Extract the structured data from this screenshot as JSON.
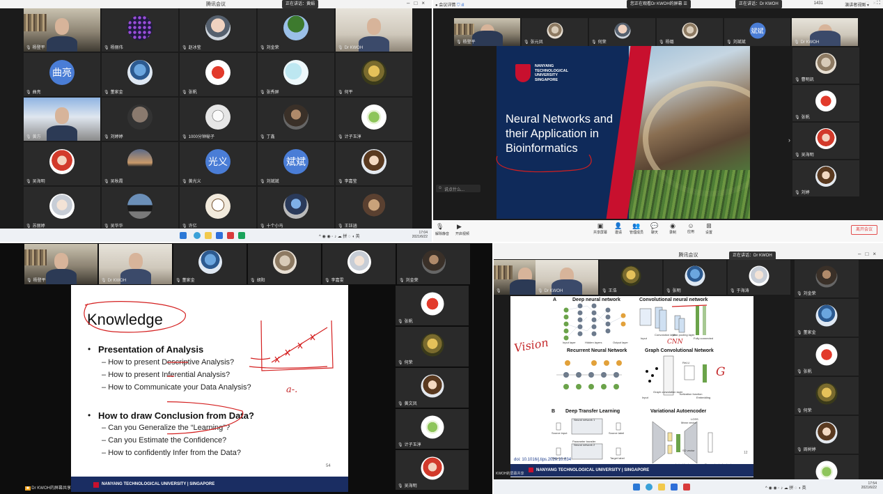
{
  "q1": {
    "title": "腾讯会议",
    "pill": "正在讲话：黄娟",
    "tiles": [
      {
        "name": "杨登平",
        "kind": "photo"
      },
      {
        "name": "杨丽伟",
        "kind": "dots"
      },
      {
        "name": "赵冰莹",
        "kind": "cartoon"
      },
      {
        "name": "刘金荣",
        "kind": "tree"
      },
      {
        "name": "Dr KWOH",
        "kind": "photo2"
      },
      {
        "name": "曲亮",
        "kind": "text",
        "text": "曲亮"
      },
      {
        "name": "董家金",
        "kind": "tree2"
      },
      {
        "name": "张帆",
        "kind": "redbird"
      },
      {
        "name": "张秀屏",
        "kind": "leaf"
      },
      {
        "name": "何平",
        "kind": "frog"
      },
      {
        "name": "黄方",
        "kind": "photo3"
      },
      {
        "name": "刘婷婷",
        "kind": "dark"
      },
      {
        "name": "1000分钟秘子",
        "kind": "sketch"
      },
      {
        "name": "丁鑫",
        "kind": "person"
      },
      {
        "name": "计子玉淳",
        "kind": "greenball"
      },
      {
        "name": "吴海明",
        "kind": "redkid"
      },
      {
        "name": "吴秋霞",
        "kind": "sunset"
      },
      {
        "name": "黄光义",
        "kind": "text",
        "text": "光义"
      },
      {
        "name": "刘斌斌",
        "kind": "text",
        "text": "斌斌"
      },
      {
        "name": "李嘉莹",
        "kind": "girl"
      },
      {
        "name": "苏丽婷",
        "kind": "oldman"
      },
      {
        "name": "吴华华",
        "kind": "car"
      },
      {
        "name": "许亿",
        "kind": "drawing"
      },
      {
        "name": "十个小马",
        "kind": "bluehead"
      },
      {
        "name": "王钰涵",
        "kind": "room"
      }
    ],
    "clock_time": "17:04",
    "clock_date": "2021/6/22"
  },
  "q2": {
    "top_pill": "您正在观看Dr KWOH的屏幕 ☰",
    "speaking_pill": "正在讲话：Dr KWOH",
    "toolbar_left": "会议详情",
    "network": "1431",
    "view_label": "演讲者视图",
    "strip_names": [
      "杨登平",
      "张元凤",
      "何荣",
      "杨璐",
      "刘斌斌",
      "Dr KWOH"
    ],
    "strip_text_tile": "斌斌",
    "side_names": [
      "曹明凯",
      "张帆",
      "吴海明",
      "刘婷"
    ],
    "slide": {
      "logo_lines": [
        "NANYANG",
        "TECHNOLOGICAL",
        "UNIVERSITY",
        "SINGAPORE"
      ],
      "title": "Neural Networks and their Application in Bioinformatics"
    },
    "chat_hint": "说点什么...",
    "bottom": {
      "left1": "解除静音",
      "left2": "开启视频",
      "items": [
        "共享屏幕",
        "邀请",
        "管理成员",
        "聊天",
        "录制",
        "应用",
        "设置"
      ],
      "leave": "离开会议"
    }
  },
  "q3": {
    "strip_names": [
      "杨登平",
      "Dr KWOH",
      "董家金",
      "胡阳",
      "李嘉雯",
      "刘金荣"
    ],
    "side_names": [
      "张帆",
      "何荣",
      "黄文凤",
      "计子玉淳",
      "吴海明"
    ],
    "slide": {
      "title": "Knowledge",
      "h1": "Presentation of Analysis",
      "s1": "How to present Descriptive Analysis?",
      "s2": "How to present Inferential Analysis?",
      "s3": "How to Communicate your Data Analysis?",
      "h2": "How to draw Conclusion from Data?",
      "s4": "Can you Generalize the “Learning”?",
      "s5": "Can you Estimate the Confidence?",
      "s6": "How to confidently Infer from the Data?",
      "page_no": "54",
      "footer": "NANYANG TECHNOLOGICAL UNIVERSITY | SINGAPORE",
      "annot_a": "a-."
    },
    "sharing_label": "Dr KWOH的屏幕共享"
  },
  "q4": {
    "title": "腾讯会议",
    "pill": "正在讲话：Dr KWOH",
    "strip_names": [
      "",
      "Dr KWOH",
      "王浩",
      "张明",
      "于海涛"
    ],
    "side_names": [
      "刘金荣",
      "董家金",
      "张帆",
      "何荣",
      "周树婷",
      "计子玉淳"
    ],
    "slide": {
      "A": "A",
      "B": "B",
      "dnn": "Deep neural network",
      "cnn": "Convolutional neural network",
      "rnn": "Recurrent Neural Network",
      "gcn": "Graph Convolutional Network",
      "dtl": "Deep Transfer Learning",
      "vae": "Variational Autoencoder",
      "doi": "doi: 10.1016/j.tips.2020.10.034",
      "footer": "NANYANG TECHNOLOGICAL UNIVERSITY | SINGAPORE",
      "vision": "Vision",
      "cnn_annot": "CNN",
      "g": "G",
      "page_no": "12",
      "labels": {
        "input_layer": "Input layer",
        "hidden_layers": "Hidden layers",
        "output_layer": "Output layer",
        "input": "Input",
        "conv_layer": "Convolution layer",
        "max_pool": "Max pooling layer",
        "fully_conn": "Fully connected",
        "graph_conv": "Graph convolution layer",
        "activation": "Activation function",
        "embedding": "Embedding",
        "relu": "ReLU",
        "source_input": "Source input",
        "source_label": "Source label",
        "target_input": "Target input",
        "target_label": "Target label",
        "nn1": "Neural network 1",
        "nn2": "Neural network 2",
        "param_transfer": "Parameter transfer",
        "encoder": "Encoder",
        "decoder": "Decoder",
        "latent": "Latent features",
        "sd": "SD vector",
        "mean": "Mean vector",
        "recon": "Reconstructed output",
        "loss": "LOSS"
      }
    },
    "sharing_label": "KWOH的屏幕共享",
    "clock_time": "17:54",
    "clock_date": "2021/6/22"
  }
}
